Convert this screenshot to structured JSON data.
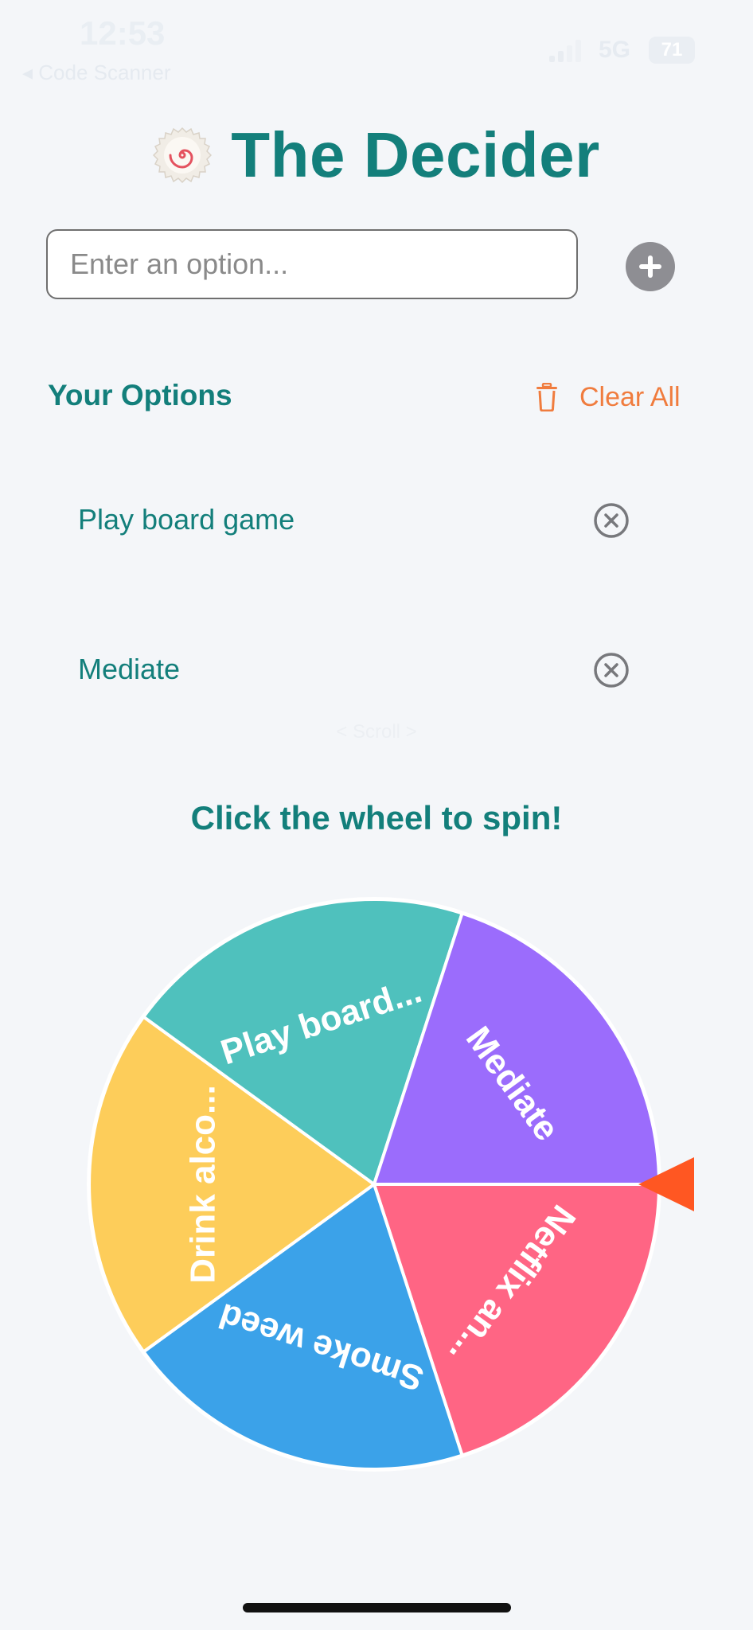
{
  "status_bar": {
    "time": "12:53",
    "back_label": "◂ Code Scanner",
    "network": "5G",
    "battery": "71"
  },
  "header": {
    "title": "The Decider",
    "logo_icon": "spiral-cookie-icon"
  },
  "input": {
    "placeholder": "Enter an option...",
    "value": ""
  },
  "options_section": {
    "heading": "Your Options",
    "clear_label": "Clear All",
    "items": [
      {
        "label": "Play board game"
      },
      {
        "label": "Mediate"
      }
    ],
    "scroll_hint": "< Scroll >"
  },
  "wheel": {
    "prompt": "Click the wheel to spin!",
    "segments": [
      {
        "label": "Netflix an...",
        "color": "#ff6584"
      },
      {
        "label": "Smoke weed",
        "color": "#3ba2e9"
      },
      {
        "label": "Drink alco...",
        "color": "#fdcd5a"
      },
      {
        "label": "Play board...",
        "color": "#4fc1bd"
      },
      {
        "label": "Mediate",
        "color": "#9b6cfc"
      }
    ],
    "pointer_color": "#ff5722"
  },
  "colors": {
    "brand": "#137f7b",
    "accent": "#f07c3e",
    "background": "#f4f6f9"
  }
}
